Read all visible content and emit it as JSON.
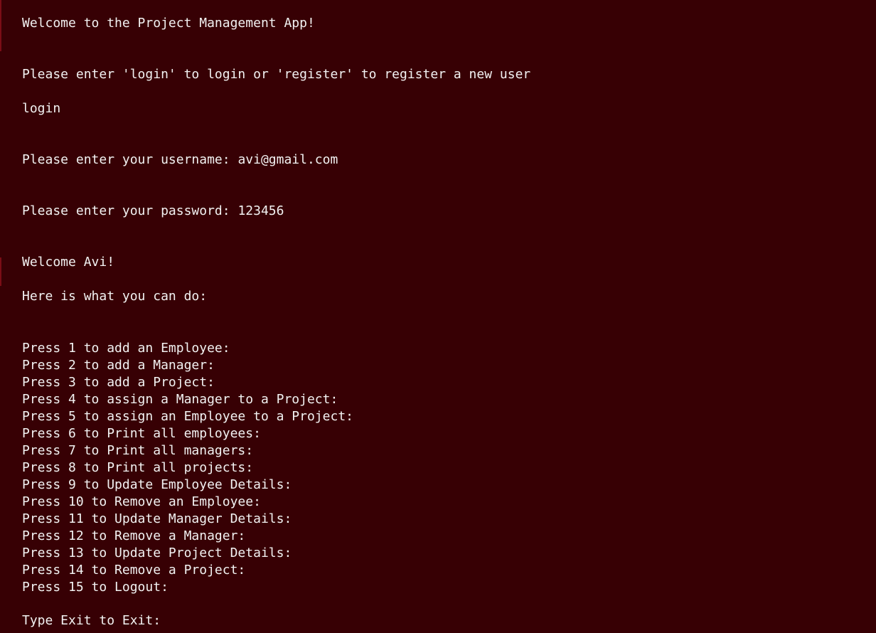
{
  "terminal": {
    "welcome": "Welcome to the Project Management App!",
    "login_prompt": "Please enter 'login' to login or 'register' to register a new user",
    "login_input": "login",
    "username_prompt": "Please enter your username: ",
    "username_value": "avi@gmail.com",
    "password_prompt": "Please enter your password: ",
    "password_value": "123456",
    "user_greeting": "Welcome Avi!",
    "options_header": "Here is what you can do:",
    "menu": [
      "Press 1 to add an Employee:",
      "Press 2 to add a Manager:",
      "Press 3 to add a Project:",
      "Press 4 to assign a Manager to a Project:",
      "Press 5 to assign an Employee to a Project:",
      "Press 6 to Print all employees:",
      "Press 7 to Print all managers:",
      "Press 8 to Print all projects:",
      "Press 9 to Update Employee Details:",
      "Press 10 to Remove an Employee:",
      "Press 11 to Update Manager Details:",
      "Press 12 to Remove a Manager:",
      "Press 13 to Update Project Details:",
      "Press 14 to Remove a Project:",
      "Press 15 to Logout:"
    ],
    "exit_prompt": "Type Exit to Exit:"
  },
  "colors": {
    "background": "#370004",
    "text": "#f2f2f2",
    "edge_accent": "#7a0d16"
  }
}
